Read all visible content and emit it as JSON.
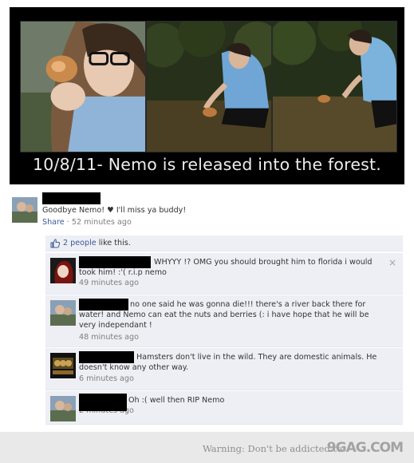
{
  "poster": {
    "caption": "10/8/11- Nemo is released into the forest.",
    "photos": [
      "girl-kissing-hamster-photo",
      "girl-releasing-hamster-photo",
      "girl-crouching-in-forest-photo"
    ]
  },
  "post": {
    "message": "Goodbye Nemo! ♥ I'll miss ya buddy!",
    "share_label": "Share",
    "separator": " · ",
    "timestamp": "52 minutes ago"
  },
  "likes": {
    "count_link": "2 people",
    "suffix": " like this."
  },
  "comments": [
    {
      "text": "WHYYY !? OMG you should brought him to florida i would took him! :'( r.i.p nemo",
      "time": "49 minutes ago"
    },
    {
      "text": "no one said he was gonna die!!! there's a river back there for water! and Nemo can eat the nuts and berries (: i have hope that he will be very independant !",
      "time": "48 minutes ago"
    },
    {
      "text": "Hamsters don't live in the wild. They are domestic animals. He doesn't know any other way.",
      "time": "6 minutes ago"
    },
    {
      "text": "Oh :( well then RIP Nemo",
      "time": "2 minutes ago"
    }
  ],
  "close_glyph": "×",
  "footer": {
    "warning": "Warning: Don't be addicted to",
    "logo": "9GAG.COM"
  },
  "colors": {
    "fb_link": "#3b5998",
    "comment_bg": "#edeff4",
    "poster_bg": "#000000",
    "footer_bg": "#e9e9e9"
  }
}
